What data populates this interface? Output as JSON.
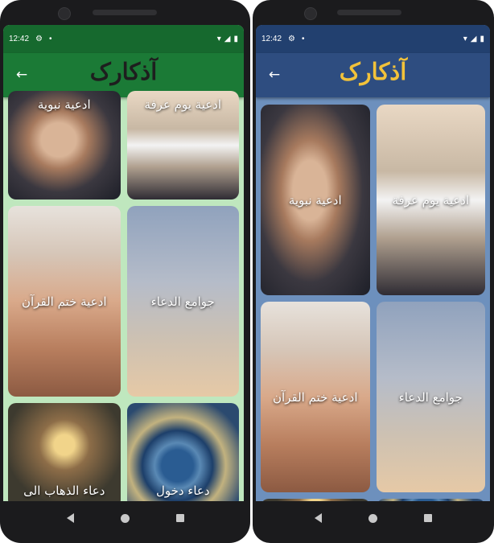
{
  "left": {
    "status": {
      "time": "12:42"
    },
    "appbar": {
      "title": "آذکارک",
      "title_color": "#1e1e1e",
      "bg": "#1b7a36"
    },
    "status_bg": "#16692e",
    "screen_bg": "#bfe7be",
    "tiles": [
      "ادعية نبوية",
      "ادعية يوم عرفة",
      "ادعية ختم القرآن",
      "جوامع الدعاء",
      "دعاء الذهاب الى",
      "دعاء دخول"
    ]
  },
  "right": {
    "status": {
      "time": "12:42"
    },
    "appbar": {
      "title": "آذکارک",
      "title_color": "#f2c23a",
      "bg": "#2e4d80"
    },
    "status_bg": "#22406f",
    "screen_bg": "#6d90bd",
    "tiles": [
      "ادعية نبوية",
      "ادعية يوم عرفة",
      "ادعية ختم القرآن",
      "جوامع الدعاء"
    ]
  }
}
